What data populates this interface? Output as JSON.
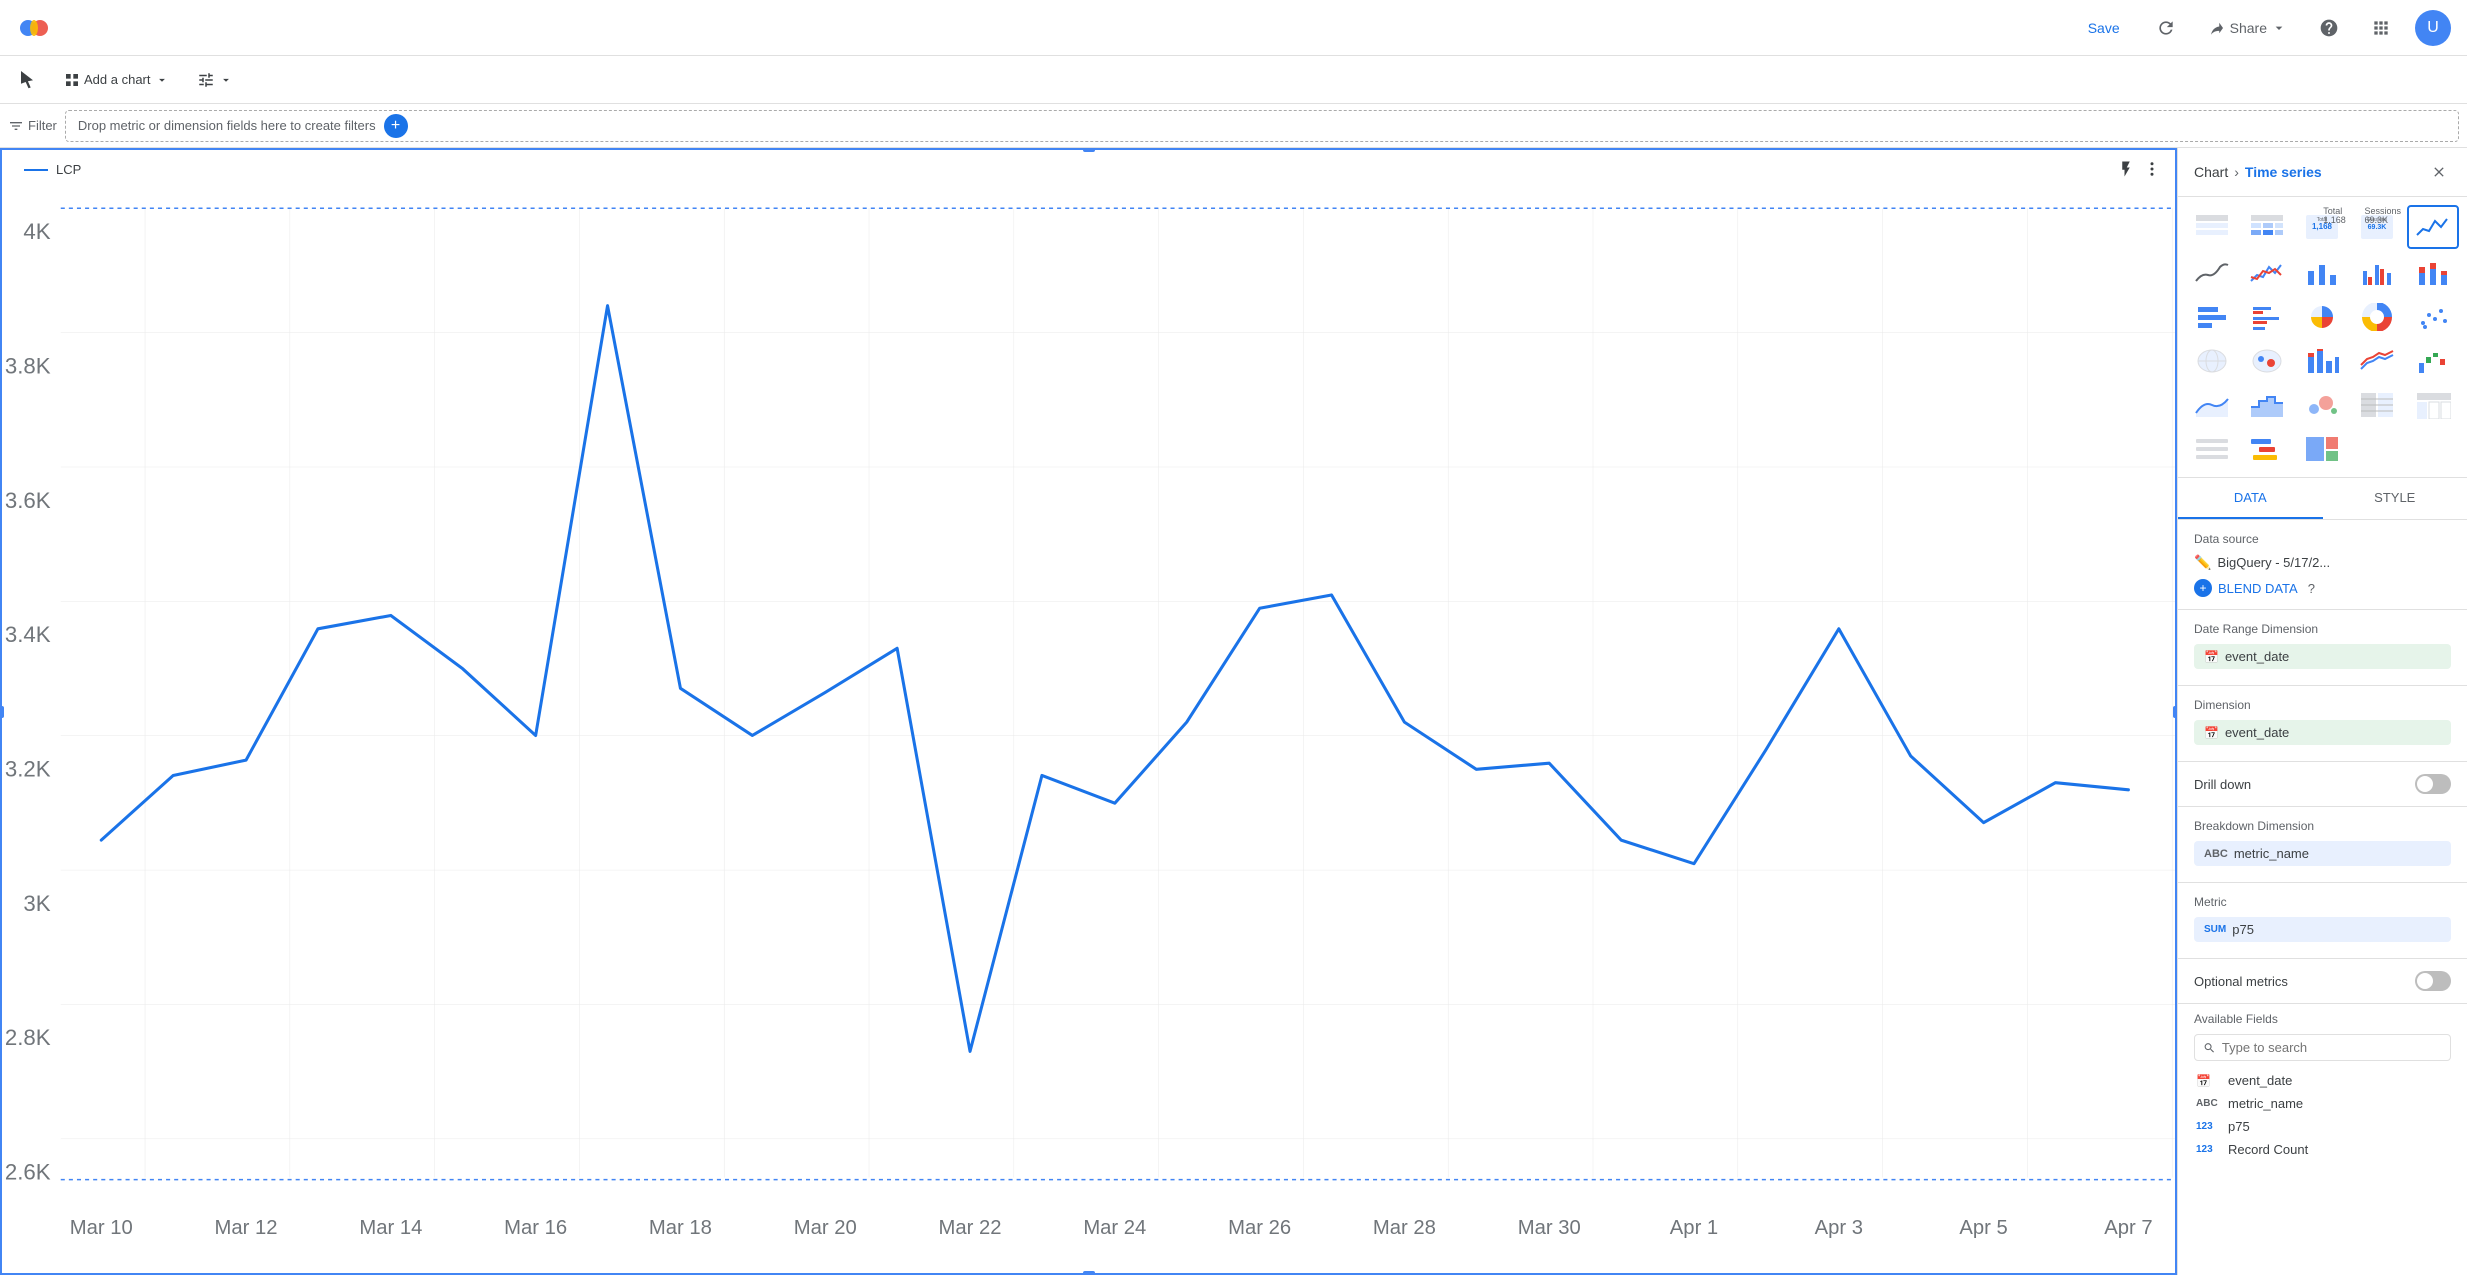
{
  "header": {
    "save_label": "Save",
    "share_label": "Share",
    "logo_text": "Looker Studio"
  },
  "toolbar": {
    "cursor_label": "",
    "add_chart_label": "Add a chart",
    "add_control_label": ""
  },
  "filter_bar": {
    "filter_label": "Filter",
    "drop_zone_text": "Drop metric or dimension fields here to create filters"
  },
  "panel": {
    "breadcrumb_base": "Chart",
    "breadcrumb_sep": "›",
    "breadcrumb_current": "Time series",
    "tab_data": "DATA",
    "tab_style": "STYLE",
    "data_source_label": "Data source",
    "data_source_name": "BigQuery - 5/17/2...",
    "blend_label": "BLEND DATA",
    "date_range_label": "Date Range Dimension",
    "date_range_field": "event_date",
    "dimension_label": "Dimension",
    "dimension_field": "event_date",
    "drill_label": "Drill down",
    "breakdown_label": "Breakdown Dimension",
    "breakdown_field": "metric_name",
    "metric_label": "Metric",
    "metric_field": "p75",
    "metric_prefix": "SUM",
    "optional_label": "Optional metrics",
    "available_fields_label": "Available Fields",
    "search_placeholder": "Type to search",
    "fields": [
      {
        "name": "event_date",
        "type": "cal",
        "type_label": ""
      },
      {
        "name": "metric_name",
        "type": "abc",
        "type_label": "ABC"
      },
      {
        "name": "p75",
        "type": "123",
        "type_label": "123"
      },
      {
        "name": "Record Count",
        "type": "123",
        "type_label": "123"
      }
    ]
  },
  "chart": {
    "legend_label": "LCP",
    "y_labels": [
      "4K",
      "3.8K",
      "3.6K",
      "3.4K",
      "3.2K",
      "3K",
      "2.8K",
      "2.6K"
    ],
    "x_labels": [
      "Mar 10",
      "Mar 12",
      "Mar 14",
      "Mar 16",
      "Mar 18",
      "Mar 20",
      "Mar 22",
      "Mar 24",
      "Mar 26",
      "Mar 28",
      "Mar 30",
      "Apr 1",
      "Apr 3",
      "Apr 5",
      "Apr 7"
    ],
    "stat1_label": "Total",
    "stat1_value": "1,168",
    "stat2_label": "Sessions",
    "stat2_value": "69.3K"
  }
}
